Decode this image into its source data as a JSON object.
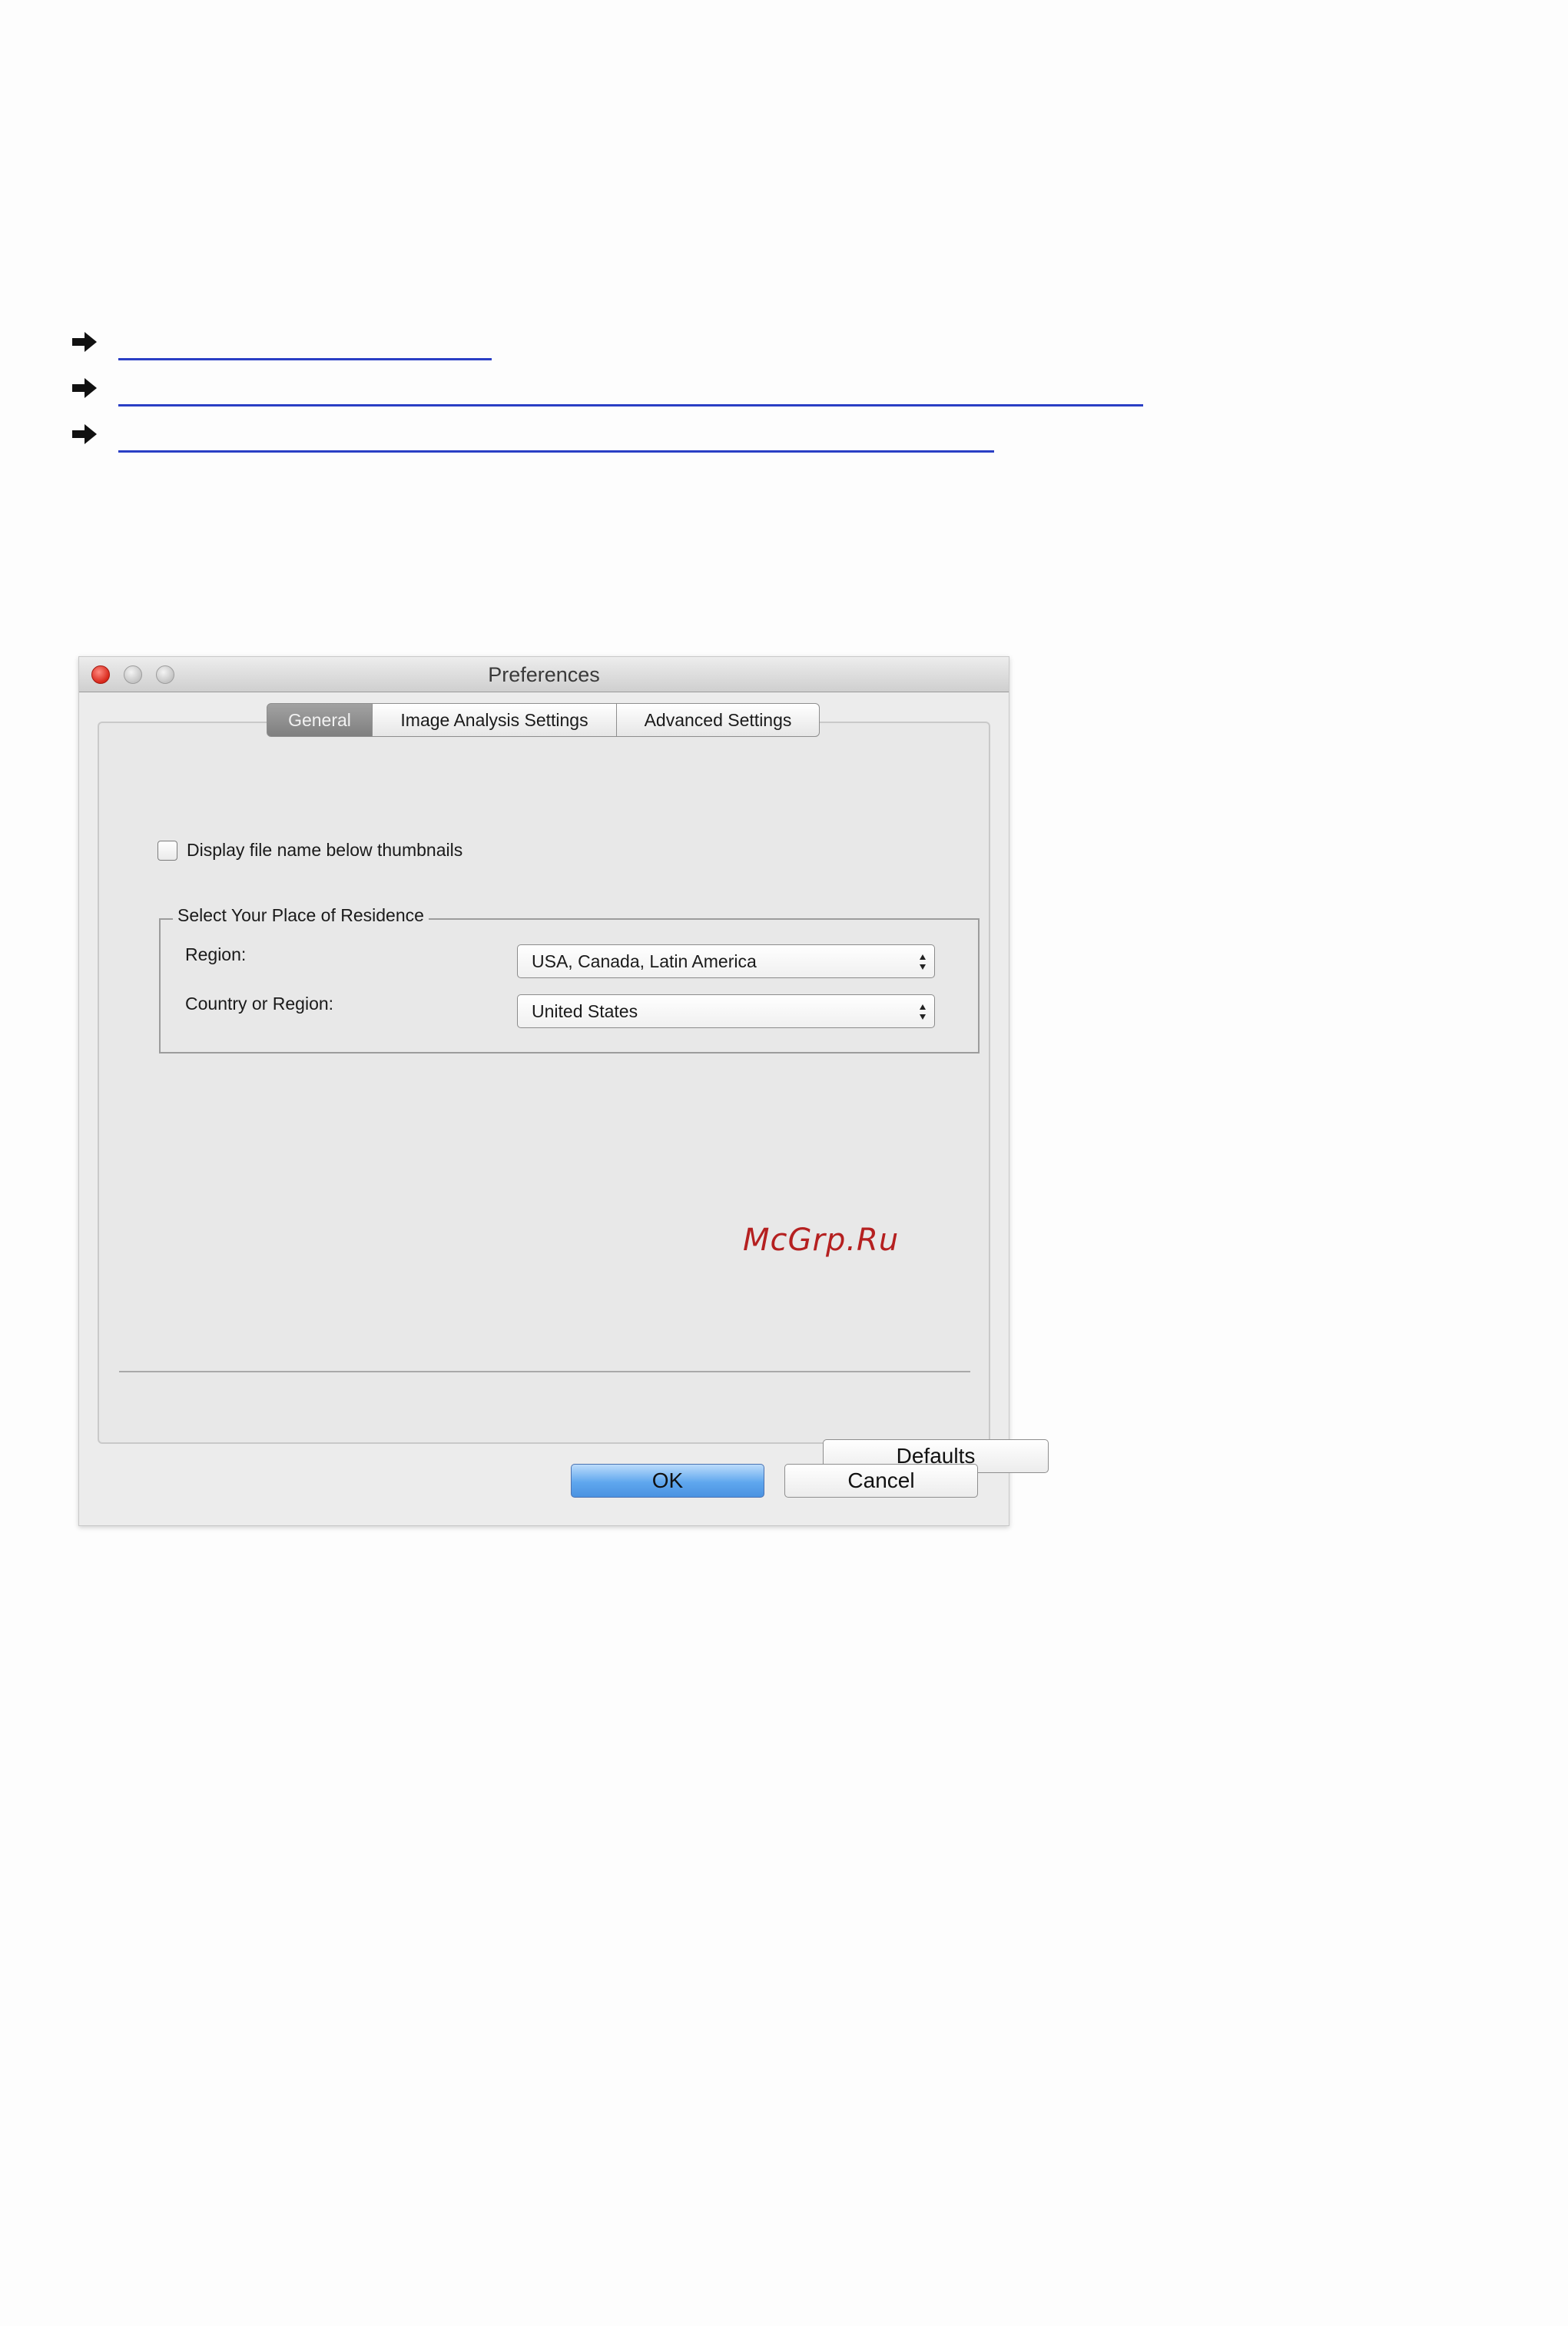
{
  "links": {
    "items": [
      {
        "icon": "arrow-right-icon",
        "text": ""
      },
      {
        "icon": "arrow-right-icon",
        "text": ""
      },
      {
        "icon": "arrow-right-icon",
        "text": ""
      }
    ],
    "link_color": "#2a3fc5"
  },
  "window": {
    "title": "Preferences",
    "controls": [
      "close-button",
      "minimize-button",
      "zoom-button"
    ]
  },
  "tabs": [
    {
      "label": "General",
      "active": true
    },
    {
      "label": "Image Analysis Settings",
      "active": false
    },
    {
      "label": "Advanced Settings",
      "active": false
    }
  ],
  "general": {
    "checkbox_label": "Display file name below thumbnails",
    "checkbox_checked": false,
    "residence": {
      "legend": "Select Your Place of Residence",
      "region_label": "Region:",
      "region_value": "USA, Canada, Latin America",
      "country_label": "Country or Region:",
      "country_value": "United States"
    },
    "defaults_label": "Defaults"
  },
  "footer": {
    "ok_label": "OK",
    "cancel_label": "Cancel"
  },
  "watermark": "McGrp.Ru",
  "colors": {
    "accent_button": "#5fa7ee",
    "close_light": "#d8271a",
    "watermark": "#b52020"
  }
}
